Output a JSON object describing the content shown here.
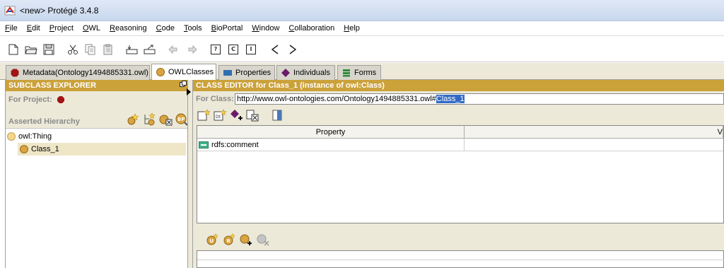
{
  "window": {
    "title": "<new>  Protégé 3.4.8"
  },
  "menu": [
    {
      "label": "File",
      "mn": "F",
      "rest": "ile"
    },
    {
      "label": "Edit",
      "mn": "E",
      "rest": "dit"
    },
    {
      "label": "Project",
      "mn": "P",
      "rest": "roject"
    },
    {
      "label": "OWL",
      "mn": "O",
      "rest": "WL"
    },
    {
      "label": "Reasoning",
      "mn": "R",
      "rest": "easoning"
    },
    {
      "label": "Code",
      "mn": "C",
      "rest": "ode"
    },
    {
      "label": "Tools",
      "mn": "T",
      "rest": "ools"
    },
    {
      "label": "BioPortal",
      "mn": "B",
      "rest": "ioPortal"
    },
    {
      "label": "Window",
      "mn": "W",
      "rest": "indow"
    },
    {
      "label": "Collaboration",
      "mn": "C",
      "rest": "ollaboration"
    },
    {
      "label": "Help",
      "mn": "H",
      "rest": "elp"
    }
  ],
  "toolbar": {
    "icons": [
      "new-file-icon",
      "open-folder-icon",
      "save-icon",
      "cut-icon",
      "copy-icon",
      "paste-icon",
      "insert-icon",
      "export-icon",
      "undo-icon",
      "redo-icon",
      "query-icon",
      "class-box-icon",
      "instance-box-icon",
      "back-arrow-icon",
      "forward-arrow-icon"
    ],
    "query_label": "?",
    "class_label": "C",
    "instance_label": "I"
  },
  "tabs": [
    {
      "label": "Metadata(Ontology1494885331.owl)",
      "icon": "metadata-icon",
      "color": "#a01515",
      "active": false
    },
    {
      "label": "OWLClasses",
      "icon": "owl-classes-icon",
      "color": "#d9a441",
      "active": true
    },
    {
      "label": "Properties",
      "icon": "properties-icon",
      "color": "#2f6fb0",
      "active": false
    },
    {
      "label": "Individuals",
      "icon": "individuals-icon",
      "color": "#6a1c6a",
      "active": false
    },
    {
      "label": "Forms",
      "icon": "forms-icon",
      "color": "#2e8b3e",
      "active": false
    }
  ],
  "subclass_explorer": {
    "header": "SUBCLASS EXPLORER",
    "for_project_label": "For Project:",
    "asserted_label": "Asserted Hierarchy",
    "tree": [
      {
        "label": "owl:Thing",
        "level": 0,
        "selected": false,
        "color": "#f2d58c"
      },
      {
        "label": "Class_1",
        "level": 1,
        "selected": true,
        "color": "#d9a441"
      }
    ]
  },
  "class_editor": {
    "header": "CLASS EDITOR for Class_1   (instance of owl:Class)",
    "for_class_label": "For Class:",
    "uri_prefix": "http://www.owl-ontologies.com/Ontology1494885331.owl#",
    "uri_selected": "Class_1",
    "table": {
      "columns": [
        "Property",
        "V"
      ],
      "rows": [
        {
          "property": "rdfs:comment",
          "value": ""
        }
      ]
    }
  },
  "colors": {
    "header_gold": "#cba13a",
    "selection_blue": "#316ac5",
    "tree_selected": "#efe6c8"
  }
}
